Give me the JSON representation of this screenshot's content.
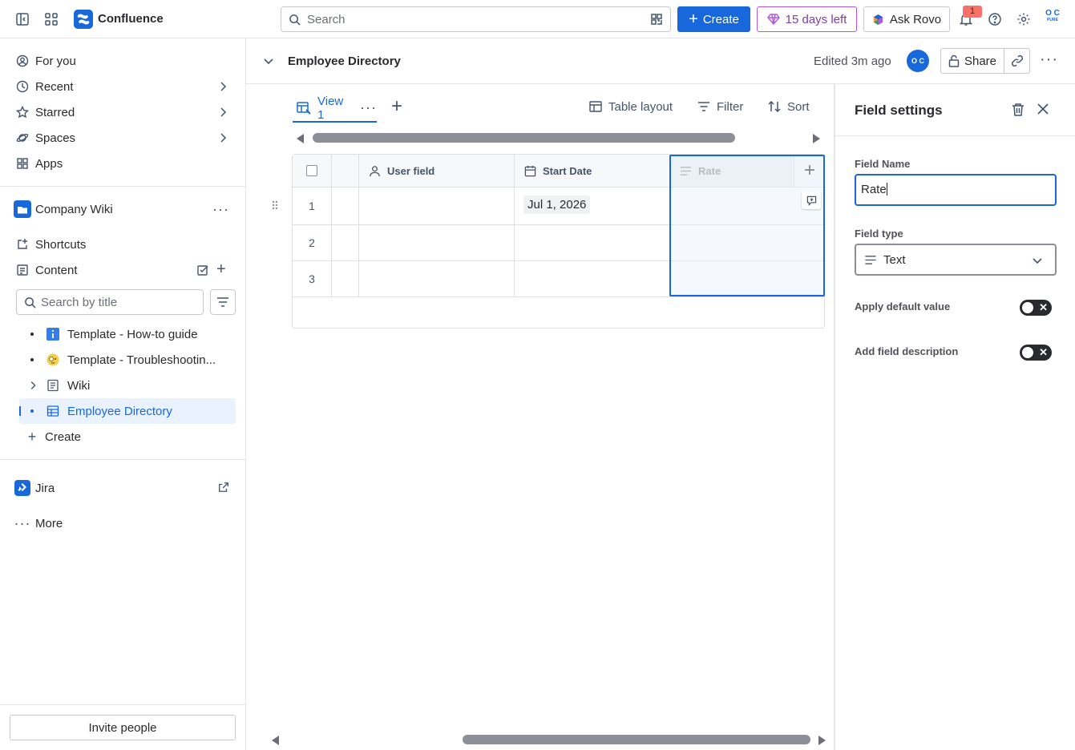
{
  "topbar": {
    "app_name": "Confluence",
    "search_placeholder": "Search",
    "create_label": "Create",
    "trial_label": "15 days left",
    "rovo_label": "Ask Rovo",
    "notification_count": "1",
    "avatar_initials": "O C",
    "avatar_sub": "PURE"
  },
  "sidebar": {
    "nav": [
      {
        "label": "For you",
        "icon": "person-circle-icon"
      },
      {
        "label": "Recent",
        "icon": "clock-icon"
      },
      {
        "label": "Starred",
        "icon": "star-icon"
      },
      {
        "label": "Spaces",
        "icon": "planet-icon"
      },
      {
        "label": "Apps",
        "icon": "apps-icon"
      }
    ],
    "space_name": "Company Wiki",
    "shortcuts_label": "Shortcuts",
    "content_label": "Content",
    "search_placeholder": "Search by title",
    "tree": [
      {
        "label": "Template - How-to guide",
        "icon": "info-icon"
      },
      {
        "label": "Template - Troubleshootin...",
        "icon": "magnifier-emoji-icon"
      },
      {
        "label": "Wiki",
        "icon": "page-icon"
      },
      {
        "label": "Employee Directory",
        "icon": "database-icon"
      }
    ],
    "create_label": "Create",
    "jira_label": "Jira",
    "more_label": "More",
    "invite_label": "Invite people"
  },
  "page": {
    "title": "Employee Directory",
    "edited": "Edited 3m ago",
    "avatar_initials": "O C",
    "share_label": "Share"
  },
  "toolbar": {
    "view_label": "View 1",
    "layout_label": "Table layout",
    "filter_label": "Filter",
    "sort_label": "Sort"
  },
  "table": {
    "columns": [
      {
        "label": "User field",
        "icon": "person-icon"
      },
      {
        "label": "Start Date",
        "icon": "calendar-icon"
      },
      {
        "label": "Rate",
        "icon": "text-lines-icon"
      }
    ],
    "rows": [
      {
        "num": "1",
        "user": "",
        "start_date": "Jul 1, 2026",
        "rate": ""
      },
      {
        "num": "2",
        "user": "",
        "start_date": "",
        "rate": ""
      },
      {
        "num": "3",
        "user": "",
        "start_date": "",
        "rate": ""
      }
    ]
  },
  "panel": {
    "title": "Field settings",
    "field_name_label": "Field Name",
    "field_name_value": "Rate",
    "field_type_label": "Field type",
    "field_type_value": "Text",
    "default_value_label": "Apply default value",
    "description_label": "Add field description"
  },
  "colors": {
    "brand_blue": "#1868db",
    "trial_purple": "#803fa5",
    "selection_bg": "#e9f2fe"
  }
}
